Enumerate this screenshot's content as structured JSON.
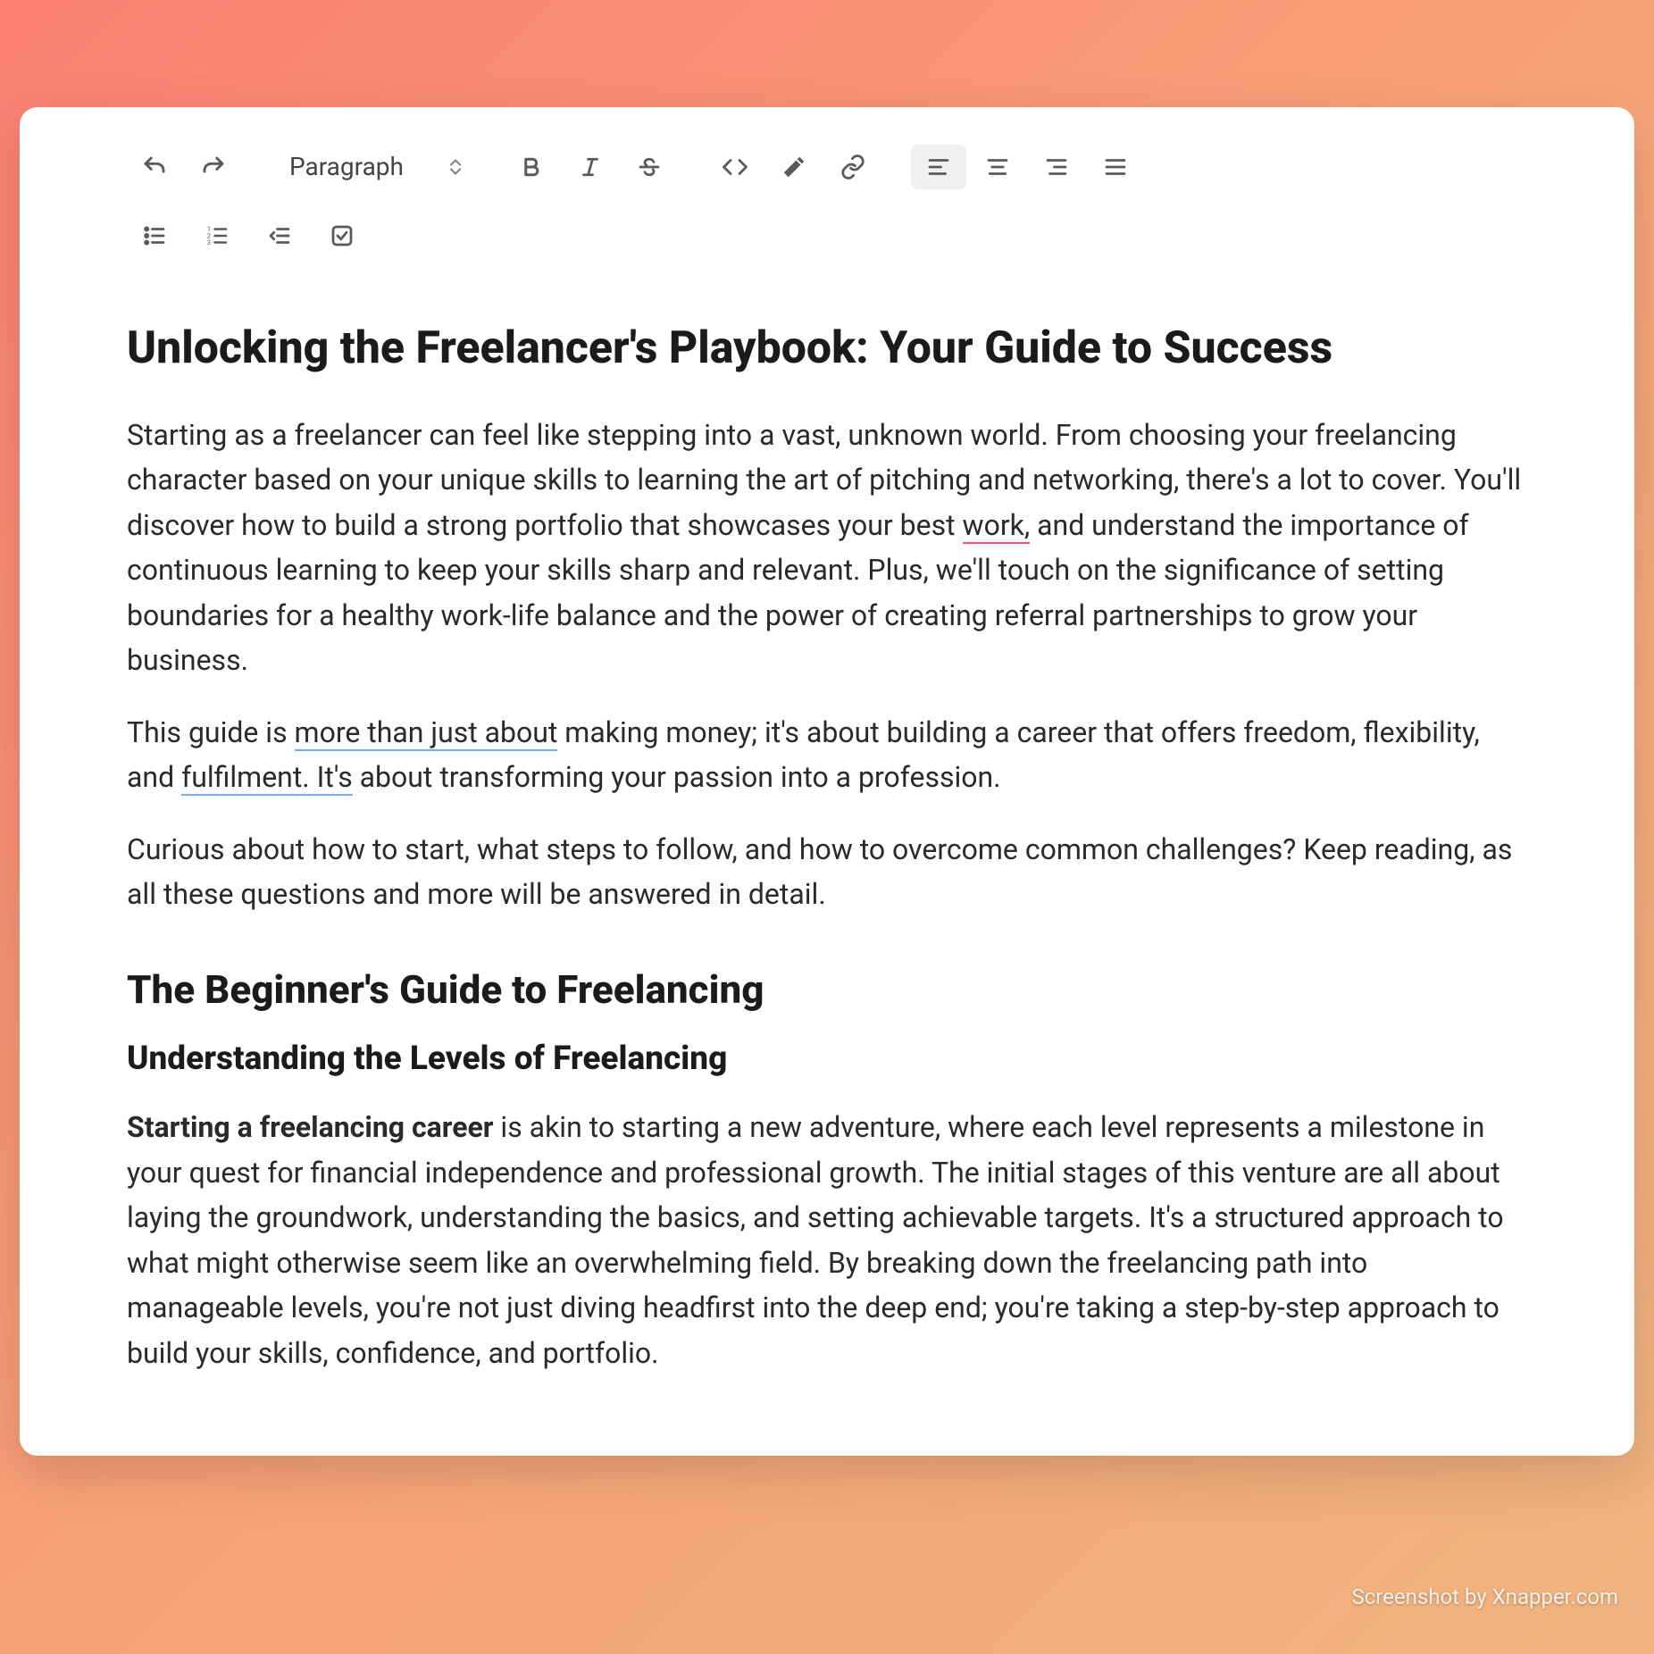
{
  "watermark": "Screenshot by Xnapper.com",
  "toolbar": {
    "paragraph_label": "Paragraph"
  },
  "doc": {
    "h1": "Unlocking the Freelancer's Playbook: Your Guide to Success",
    "p1a": "Starting as a freelancer can feel like stepping into a vast, unknown world. From choosing your freelancing character based on your unique skills to learning the art of pitching and networking, there's a lot to cover. You'll discover how to build a strong portfolio that showcases your best ",
    "p1_work": "work,",
    "p1b": " and understand the importance of continuous learning to keep your skills sharp and relevant. Plus, we'll touch on the significance of setting boundaries for a healthy work-life balance and the power of creating referral partnerships to grow your business.",
    "p2a": "This guide is ",
    "p2_span1": "more than just about",
    "p2b": " making money; it's about building a career that offers freedom, flexibility, and ",
    "p2_span2": "fulfilment. It's",
    "p2c": " about transforming your passion into a profession.",
    "p3": "Curious about how to start, what steps to follow, and how to overcome common challenges? Keep reading, as all these questions and more will be answered in detail.",
    "h2": "The Beginner's Guide to Freelancing",
    "h3": "Understanding the Levels of Freelancing",
    "p4_bold": "Starting a freelancing career",
    "p4_rest": " is akin to starting a new adventure, where each level represents a milestone in your quest for financial independence and professional growth. The initial stages of this venture are all about laying the groundwork, understanding the basics, and setting achievable targets. It's a structured approach to what might otherwise seem like an overwhelming field. By breaking down the freelancing path into manageable levels, you're not just diving headfirst into the deep end; you're taking a step-by-step approach to build your skills, confidence, and portfolio."
  }
}
